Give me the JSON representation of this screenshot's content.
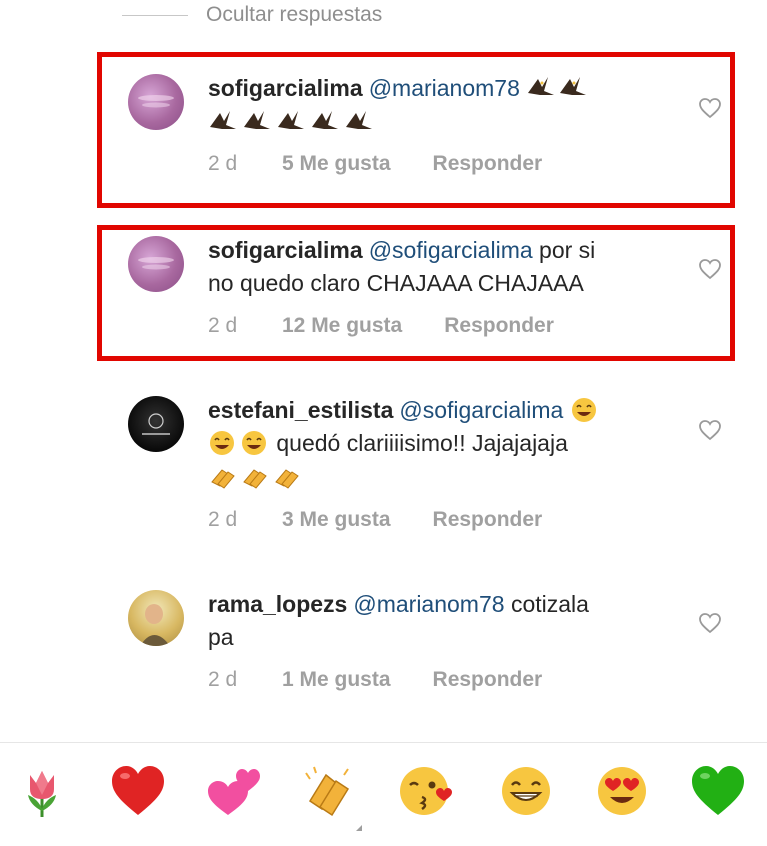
{
  "thread": {
    "hide_replies": "Ocultar respuestas"
  },
  "comments": [
    {
      "username": "sofigarcialima",
      "mention": "@marianom78",
      "text": "",
      "line2": "",
      "age": "2 d",
      "likes": "5 Me gusta",
      "reply": "Responder",
      "avatar": "avatar-purple",
      "highlighted": true
    },
    {
      "username": "sofigarcialima",
      "mention": "@sofigarcialima",
      "text": "por si",
      "line2": "no quedo claro CHAJAAA CHAJAAA",
      "age": "2 d",
      "likes": "12 Me gusta",
      "reply": "Responder",
      "avatar": "avatar-purple",
      "highlighted": true
    },
    {
      "username": "estefani_estilista",
      "mention": "@sofigarcialima",
      "text": "",
      "line2": "quedó clariiiisimo!! Jajajajaja",
      "age": "2 d",
      "likes": "3 Me gusta",
      "reply": "Responder",
      "avatar": "avatar-black",
      "highlighted": false
    },
    {
      "username": "rama_lopezs",
      "mention": "@marianom78",
      "text": "cotizala",
      "line2": "pa",
      "age": "2 d",
      "likes": "1 Me gusta",
      "reply": "Responder",
      "avatar": "avatar-yellow",
      "highlighted": false
    }
  ],
  "emoji_bar": [
    "tulip",
    "red-heart",
    "two-hearts",
    "clapping-hands",
    "face-blowing-kiss",
    "grinning-face",
    "heart-eyes-face",
    "green-heart"
  ],
  "colors": {
    "highlight": "#e10600",
    "mention": "#1f4e79",
    "meta": "#a0a0a0"
  }
}
